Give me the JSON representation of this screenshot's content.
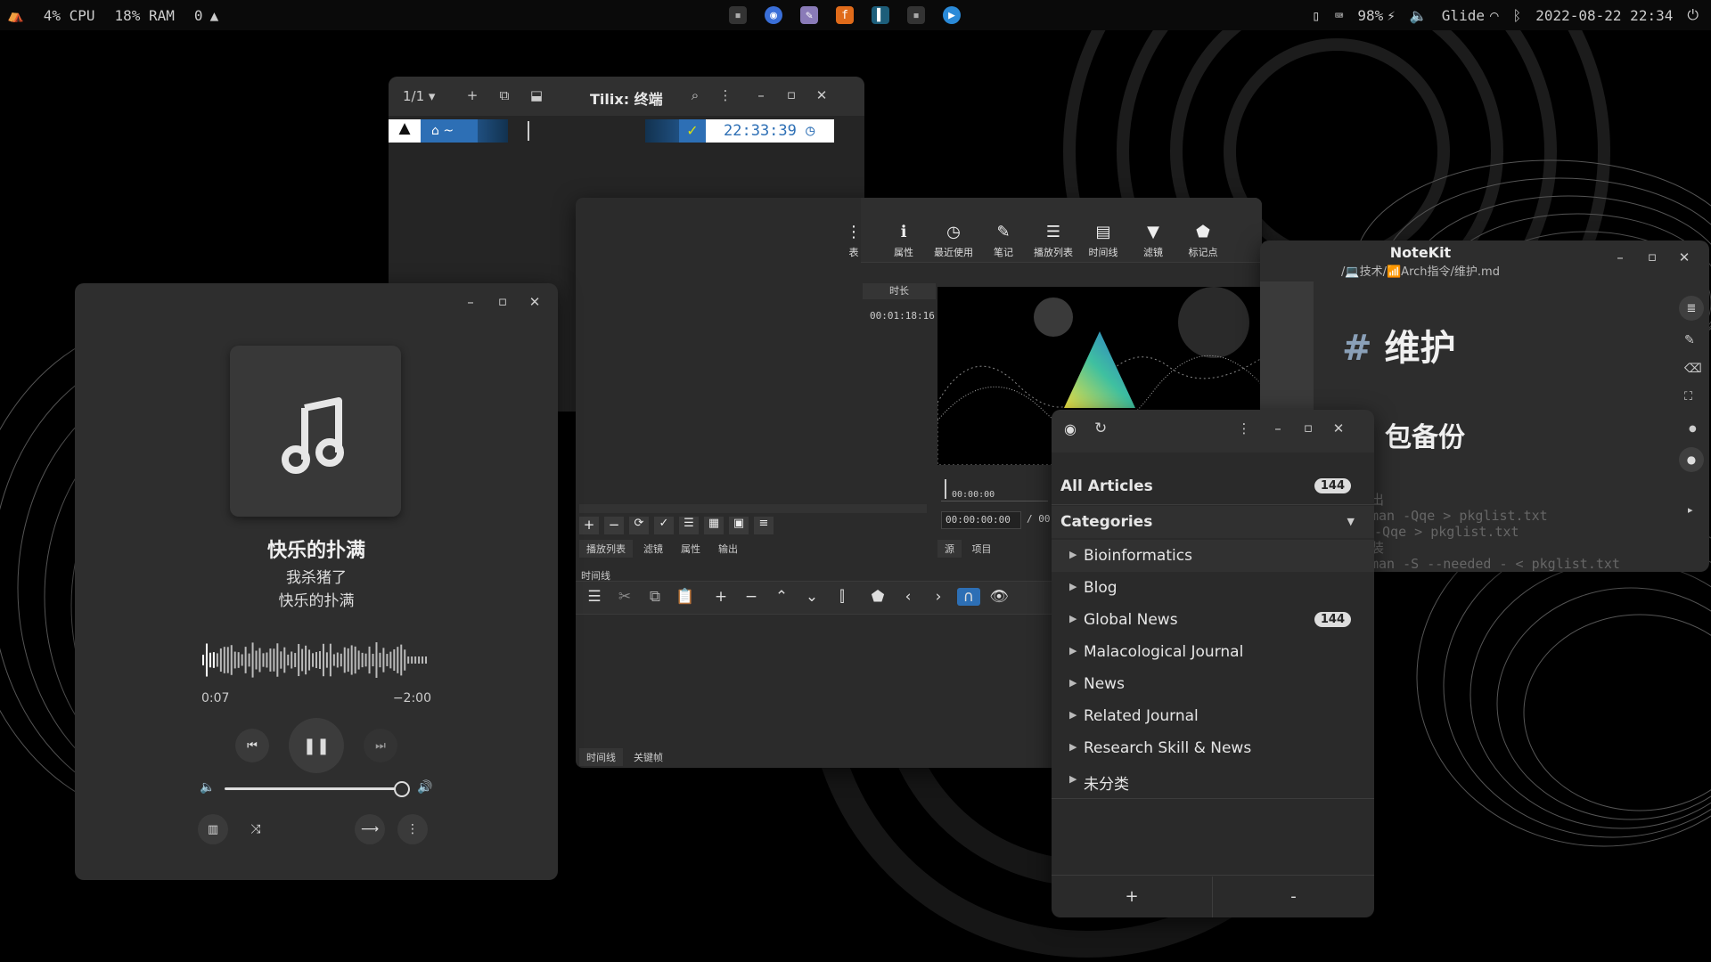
{
  "topbar": {
    "cpu": "4% CPU",
    "ram": "18% RAM",
    "workspace": "0",
    "battery": "98%",
    "network": "Glide",
    "datetime": "2022-08-22 22:34"
  },
  "terminal": {
    "title": "Tilix: 终端",
    "session": "1/1",
    "prompt_path": "~",
    "clock": "22:33:39"
  },
  "music": {
    "title": "快乐的扑满",
    "artist": "我杀猪了",
    "album": "快乐的扑满",
    "elapsed": "0:07",
    "remaining": "−2:00",
    "progress": 0.05,
    "volume": 1.0
  },
  "shotcut": {
    "toolbar": [
      "表",
      "属性",
      "最近使用",
      "笔记",
      "播放列表",
      "时间线",
      "滤镜",
      "标记点"
    ],
    "duration_header": "时长",
    "duration_value": "00:01:18:16",
    "timecode": "00:00:00:00",
    "timecode_sep": "/ 00:",
    "ruler_start": "00:00:00",
    "playlist_tabs": [
      "播放列表",
      "滤镜",
      "属性",
      "输出"
    ],
    "source_tabs": [
      "源",
      "项目"
    ],
    "timeline_label": "时间线",
    "bottom_tabs": [
      "时间线",
      "关键帧"
    ]
  },
  "notekit": {
    "title": "NoteKit",
    "path": "/💻技术/📶Arch指令/维护.md",
    "heading_hash": "#",
    "heading": "维护",
    "subheading": "包备份",
    "code": [
      {
        "prefix": "出",
        "text": ""
      },
      {
        "prefix": "",
        "text": "man -Qqe > pkglist.txt"
      },
      {
        "prefix": "",
        "text": "-Qqe > pkglist.txt"
      },
      {
        "prefix": "装",
        "text": ""
      },
      {
        "prefix": "",
        "text": "man -S --needed - < pkglist.txt"
      }
    ]
  },
  "feeds": {
    "all_articles": "All Articles",
    "all_count": "144",
    "categories": "Categories",
    "items": [
      {
        "label": "Bioinformatics",
        "count": ""
      },
      {
        "label": "Blog",
        "count": ""
      },
      {
        "label": "Global News",
        "count": "144"
      },
      {
        "label": "Malacological Journal",
        "count": ""
      },
      {
        "label": "News",
        "count": ""
      },
      {
        "label": "Related Journal",
        "count": ""
      },
      {
        "label": "Research Skill & News",
        "count": ""
      },
      {
        "label": "未分类",
        "count": ""
      }
    ],
    "add_label": "+",
    "remove_label": "-"
  }
}
